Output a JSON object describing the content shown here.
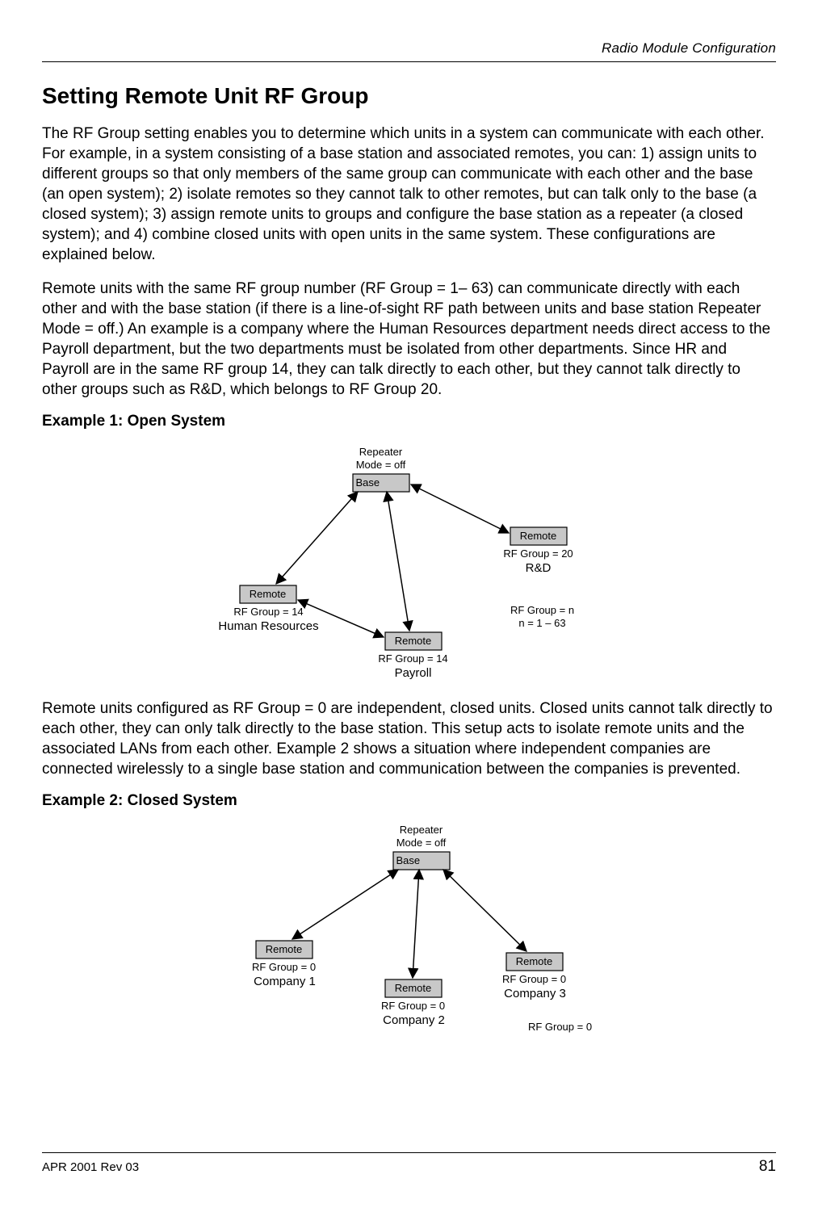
{
  "header": {
    "section": "Radio Module Configuration"
  },
  "title": "Setting Remote Unit RF Group",
  "para1": "The RF Group setting enables you to determine which units in a system can communicate with each other. For example, in a system consisting of a base station and associated remotes, you can: 1) assign units to different groups so that only members of the same group can communicate with each other and the base (an open system); 2) isolate remotes so they cannot talk to other remotes, but can talk only to the base (a closed system); 3) assign remote units to groups and configure the base station as a repeater (a closed system); and 4) combine closed units with open units in the same system.  These configurations are explained below.",
  "para2": "Remote units with the same RF group number (RF Group = 1– 63) can communicate directly with each other and with the base station (if there is a line-of-sight RF path between units and base station Repeater Mode = off.) An example is a company where the Human Resources department needs direct access to the Payroll department, but the two departments must be isolated from other departments. Since HR and Payroll are in the same RF group 14, they can talk directly to each other, but they cannot talk directly to other groups such as R&D, which belongs to RF Group 20.",
  "ex1": {
    "heading": "Example 1: Open System"
  },
  "d1": {
    "repeater": "Repeater",
    "mode": "Mode = off",
    "base": "Base",
    "remote": "Remote",
    "rd_group": "RF Group = 20",
    "rd_name": "R&D",
    "hr_group": "RF Group = 14",
    "hr_name": "Human Resources",
    "pay_group": "RF Group = 14",
    "pay_name": "Payroll",
    "n_group": "RF Group = n",
    "n_range": "n = 1 – 63"
  },
  "para3": "Remote units configured as RF Group = 0 are independent, closed units. Closed units cannot talk directly to each other, they can only talk directly to the base station. This setup acts to isolate remote units and the associated LANs from each other. Example 2 shows a situation where independent companies are connected wirelessly to a single base station and communication between the companies is prevented.",
  "ex2": {
    "heading": "Example 2: Closed System"
  },
  "d2": {
    "repeater": "Repeater",
    "mode": "Mode = off",
    "base": "Base",
    "remote": "Remote",
    "c1_group": "RF Group = 0",
    "c1_name": "Company 1",
    "c2_group": "RF Group = 0",
    "c2_name": "Company 2",
    "c3_group": "RF Group = 0",
    "c3_name": "Company 3",
    "aside": "RF Group = 0"
  },
  "footer": {
    "left": "APR 2001 Rev 03",
    "page": "81"
  }
}
